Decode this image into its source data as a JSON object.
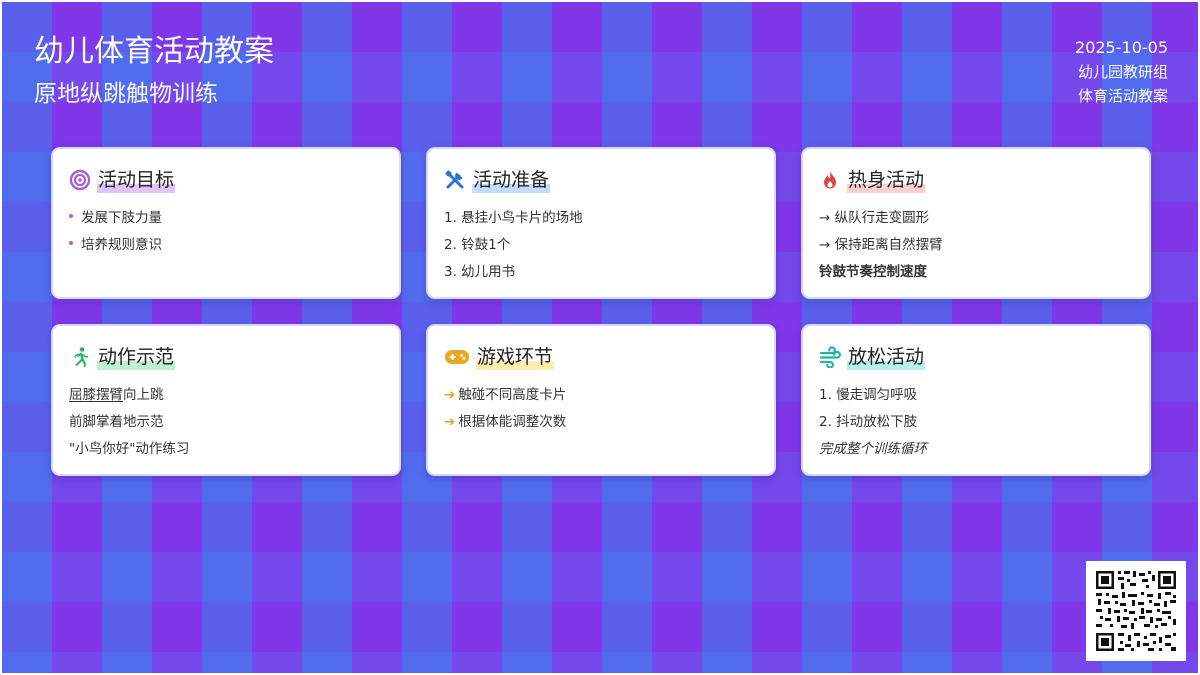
{
  "header": {
    "title": "幼儿体育活动教案",
    "subtitle": "原地纵跳触物训练",
    "date": "2025-10-05",
    "org": "幼儿园教研组",
    "doc_type": "体育活动教案"
  },
  "cards": {
    "goals": {
      "title": "活动目标",
      "icon": "target-icon",
      "items": [
        "发展下肢力量",
        "培养规则意识"
      ]
    },
    "prep": {
      "title": "活动准备",
      "icon": "tools-icon",
      "items": [
        "1. 悬挂小鸟卡片的场地",
        "2. 铃鼓1个",
        "3. 幼儿用书"
      ]
    },
    "warmup": {
      "title": "热身活动",
      "icon": "fire-icon",
      "items": [
        "→ 纵队行走变圆形",
        "→ 保持距离自然摆臂"
      ],
      "note": "铃鼓节奏控制速度"
    },
    "demo": {
      "title": "动作示范",
      "icon": "running-icon",
      "line1_underlined": "屈膝摆臂",
      "line1_rest": "向上跳",
      "line2": "前脚掌着地示范",
      "line3": "\"小鸟你好\"动作练习"
    },
    "game": {
      "title": "游戏环节",
      "icon": "gamepad-icon",
      "items": [
        "触碰不同高度卡片",
        "根据体能调整次数"
      ]
    },
    "relax": {
      "title": "放松活动",
      "icon": "wind-icon",
      "items": [
        "1. 慢走调匀呼吸",
        "2. 抖动放松下肢"
      ],
      "note": "完成整个训练循环"
    }
  },
  "colors": {
    "goals_accent": "#a55fd8",
    "prep_accent": "#2f6fd6",
    "warmup_accent": "#e0443e",
    "demo_accent": "#27b35a",
    "game_accent": "#e9a823",
    "relax_accent": "#1fb5a0"
  }
}
